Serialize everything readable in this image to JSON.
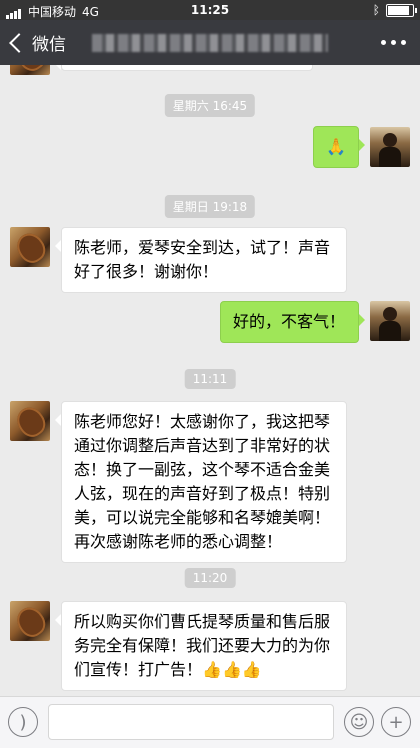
{
  "status_bar": {
    "carrier": "中国移动",
    "network": "4G",
    "time": "11:25",
    "icons": [
      "signal-icon",
      "bluetooth-icon",
      "battery-icon"
    ]
  },
  "nav": {
    "back_label": "微信",
    "title": "",
    "more_icon": "more-dots-icon"
  },
  "messages": [
    {
      "type": "time",
      "text": "星期六 16:45"
    },
    {
      "type": "out",
      "emoji": "🙏"
    },
    {
      "type": "time",
      "text": "星期日 19:18"
    },
    {
      "type": "in",
      "text": "陈老师，爱琴安全到达，试了！声音好了很多！谢谢你！"
    },
    {
      "type": "out",
      "text": "好的，不客气！"
    },
    {
      "type": "time",
      "text": "11:11"
    },
    {
      "type": "in",
      "text": "陈老师您好！太感谢你了，我这把琴通过你调整后声音达到了非常好的状态！换了一副弦，这个琴不适合金美人弦，现在的声音好到了极点！特别美，可以说完全能够和名琴媲美啊！再次感谢陈老师的悉心调整！"
    },
    {
      "type": "time",
      "text": "11:20"
    },
    {
      "type": "in",
      "text": "所以购买你们曹氏提琴质量和售后服务完全有保障！我们还要大力的为你们宣传！打广告！",
      "emoji": "👍👍👍"
    }
  ],
  "input_bar": {
    "voice_icon": "voice-icon",
    "emoji_icon": "emoji-icon",
    "add_icon": "plus-icon"
  }
}
